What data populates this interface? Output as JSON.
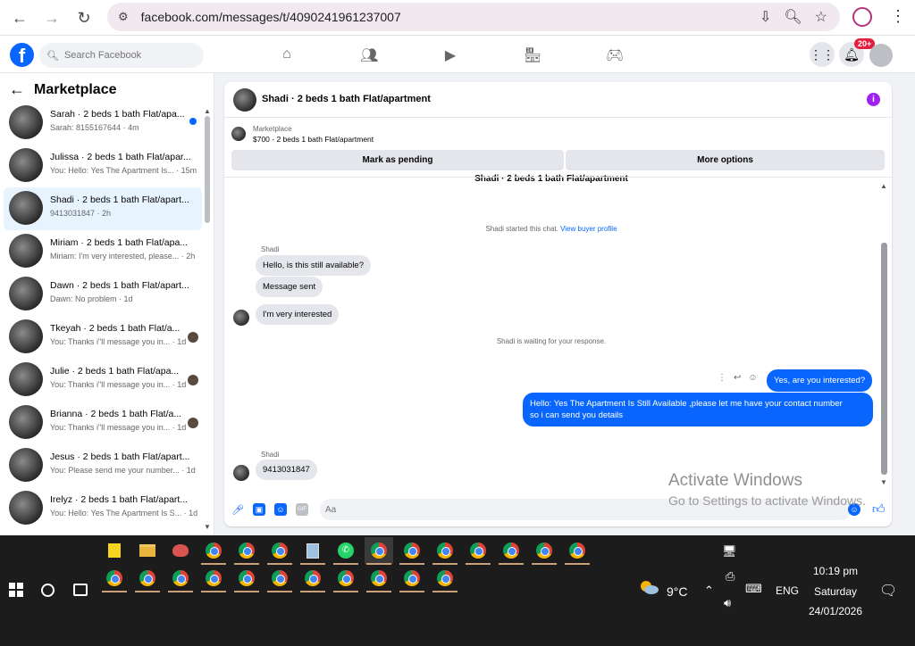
{
  "browser": {
    "url": "facebook.com/messages/t/4090241961237007"
  },
  "fb": {
    "search_placeholder": "Search Facebook",
    "notifications_count": "20+"
  },
  "sidebar": {
    "title": "Marketplace",
    "conversations": [
      {
        "title": "Sarah · 2 beds 1 bath Flat/apa...",
        "preview": "Sarah: 8155167644 · 4m",
        "unread": true,
        "active": false
      },
      {
        "title": "Julissa · 2 beds 1 bath Flat/apar...",
        "preview": "You: Hello: Yes The Apartment Is... · 15m",
        "unread": false,
        "active": false
      },
      {
        "title": "Shadi · 2 beds 1 bath Flat/apart...",
        "preview": "9413031847 · 2h",
        "unread": false,
        "active": true
      },
      {
        "title": "Miriam · 2 beds 1 bath Flat/apa...",
        "preview": "Miriam: I'm very interested, please... · 2h",
        "unread": false,
        "active": false
      },
      {
        "title": "Dawn · 2 beds 1 bath Flat/apart...",
        "preview": "Dawn: No problem · 1d",
        "unread": false,
        "active": false
      },
      {
        "title": "Tkeyah · 2 beds 1 bath Flat/a...",
        "preview": "You: Thanks i\"ll message you in... · 1d",
        "unread": false,
        "active": false,
        "seen": true
      },
      {
        "title": "Julie · 2 beds 1 bath Flat/apa...",
        "preview": "You: Thanks i\"ll message you in... · 1d",
        "unread": false,
        "active": false,
        "seen": true
      },
      {
        "title": "Brianna · 2 beds 1 bath Flat/a...",
        "preview": "You: Thanks i\"ll message you in... · 1d",
        "unread": false,
        "active": false,
        "seen": true
      },
      {
        "title": "Jesus · 2 beds 1 bath Flat/apart...",
        "preview": "You: Please send me your number... · 1d",
        "unread": false,
        "active": false
      },
      {
        "title": "Irelyz · 2 beds 1 bath Flat/apart...",
        "preview": "You: Hello: Yes The Apartment Is S... · 1d",
        "unread": false,
        "active": false
      }
    ]
  },
  "chat": {
    "title": "Shadi · 2 beds 1 bath Flat/apartment",
    "listing_label": "Marketplace",
    "listing_price": "$700 - 2 beds 1 bath Flat/apartment",
    "btn_pending": "Mark as pending",
    "btn_more": "More options",
    "cut_title": "Shadi · 2 beds 1 bath Flat/apartment",
    "started_note": "Shadi started this chat.",
    "view_profile": "View buyer profile",
    "sender1": "Shadi",
    "msg1": "Hello, is this still available?",
    "msg2": "Message sent",
    "msg3": "I'm very interested",
    "waiting_note": "Shadi is waiting for your response.",
    "out1": "Yes, are you interested?",
    "out2_line1": "Hello: Yes The Apartment Is Still Available ,please let me have your contact number",
    "out2_line2": "so i can send you details",
    "sender2": "Shadi",
    "msg4": "9413031847",
    "composer_placeholder": "Aa"
  },
  "watermark": {
    "line1": "Activate Windows",
    "line2": "Go to Settings to activate Windows."
  },
  "taskbar": {
    "temperature": "9°C",
    "language": "ENG",
    "time": "10:19 pm",
    "day": "Saturday",
    "date": "24/01/2026"
  }
}
